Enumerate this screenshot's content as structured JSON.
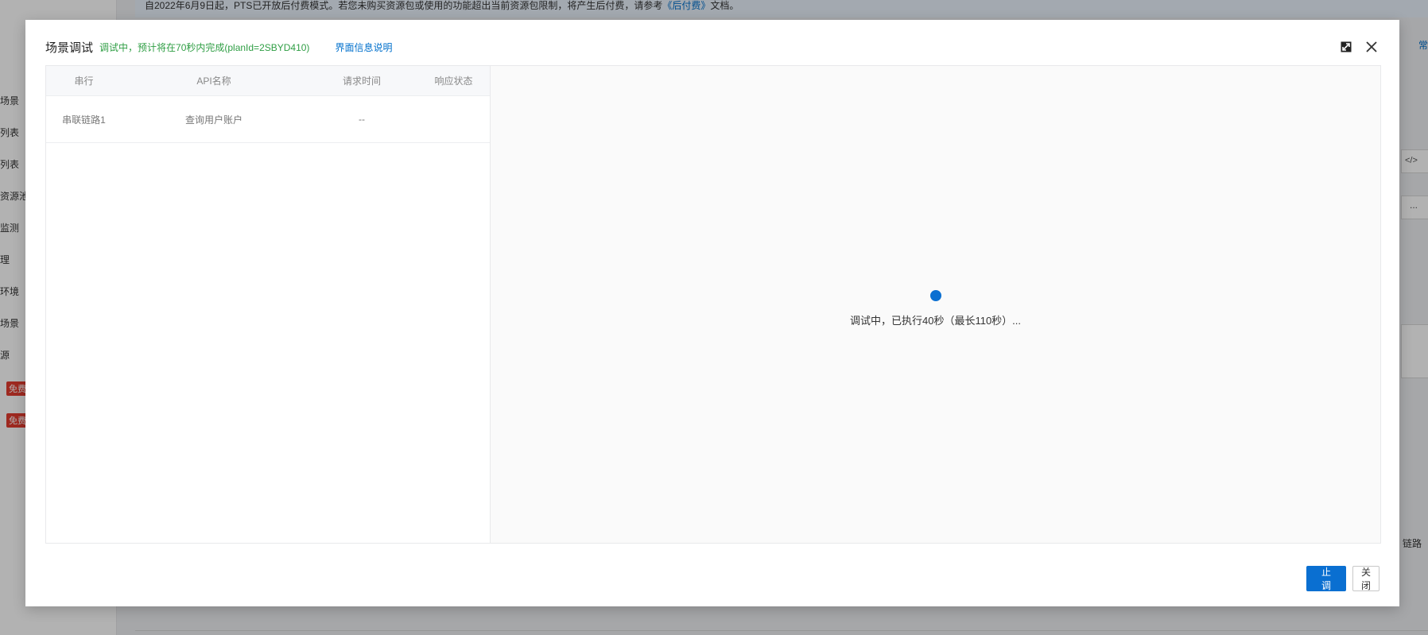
{
  "background": {
    "notice_text": "自2022年6月9日起，PTS已开放后付费模式。若您未购买资源包或使用的功能超出当前资源包限制，将产生后付费，请参考",
    "notice_link": "《后付费》",
    "notice_suffix": "文档。",
    "sidebar_items": [
      "场景",
      "列表",
      "列表",
      "资源池",
      "监测",
      "理",
      "环境",
      "场景",
      "源"
    ],
    "badges": [
      "免费",
      "免费"
    ],
    "right_texts": [
      "常",
      "</>",
      "...",
      "链路"
    ]
  },
  "dialog": {
    "title": "场景调试",
    "status": "调试中，预计将在70秒内完成(planId=2SBYD410)",
    "info_link": "界面信息说明",
    "table": {
      "columns": [
        "串行",
        "API名称",
        "请求时间",
        "响应状态"
      ],
      "rows": [
        {
          "serial": "串联链路1",
          "api": "查询用户账户",
          "time": "--",
          "status": ""
        }
      ]
    },
    "loading_text": "调试中，已执行40秒（最长110秒）...",
    "buttons": {
      "stop": "停止调试",
      "close": "关闭"
    },
    "icons": {
      "maximize": "maximize-icon",
      "close": "close-icon"
    },
    "colors": {
      "primary": "#0a6fd1",
      "status_green": "#2f9e44",
      "link_blue": "#0070cc"
    }
  }
}
